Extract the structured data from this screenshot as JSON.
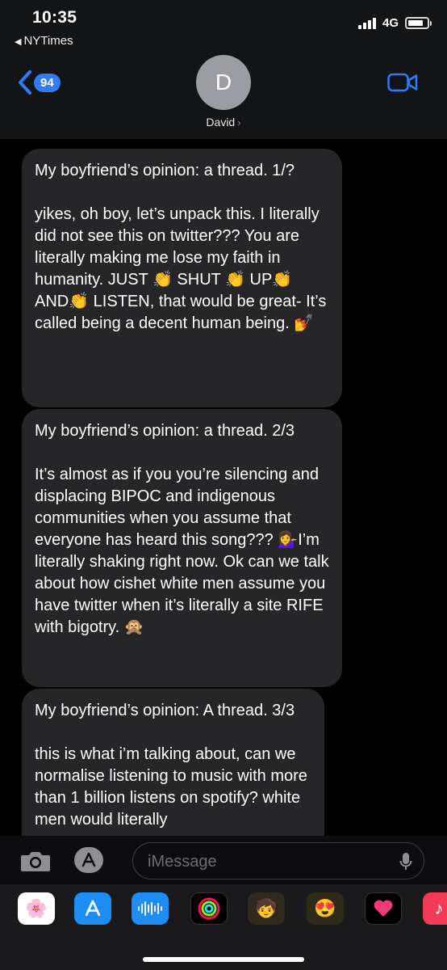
{
  "status_bar": {
    "time": "10:35",
    "back_app": "NYTimes",
    "network": "4G",
    "battery_level": 0.7
  },
  "header": {
    "unread_count": "94",
    "avatar_initial": "D",
    "contact_name": "David",
    "accent_color": "#2f7cf6"
  },
  "messages": [
    {
      "text": "My boyfriend’s opinion: a thread. 1/?\n\nyikes, oh boy, let’s unpack this. I literally did not see this on twitter??? You are literally making me lose my faith in humanity. JUST 👏 SHUT 👏 UP👏 AND👏 LISTEN, that would be great- It’s called being a decent human being. 💅"
    },
    {
      "text": "My boyfriend’s opinion: a thread. 2/3\n\nIt’s almost as if you you’re silencing and displacing BIPOC and indigenous communities when you assume that everyone has heard this song??? 💁‍♀️I’m literally shaking right now. Ok can we talk about how cishet white men assume you have twitter when it’s literally a site RIFE with bigotry. 🙊"
    },
    {
      "text": "My boyfriend’s opinion: A thread. 3/3\n\nthis is what i’m talking about, can we normalise listening to music with more than 1 billion listens on spotify? white men would literally"
    }
  ],
  "input": {
    "placeholder": "iMessage"
  },
  "app_drawer": {
    "apps": [
      "photos-icon",
      "app-store-icon",
      "audio-message-icon",
      "fitness-icon",
      "memoji-icon",
      "memoji-stickers-icon",
      "digital-touch-icon",
      "music-icon"
    ]
  }
}
